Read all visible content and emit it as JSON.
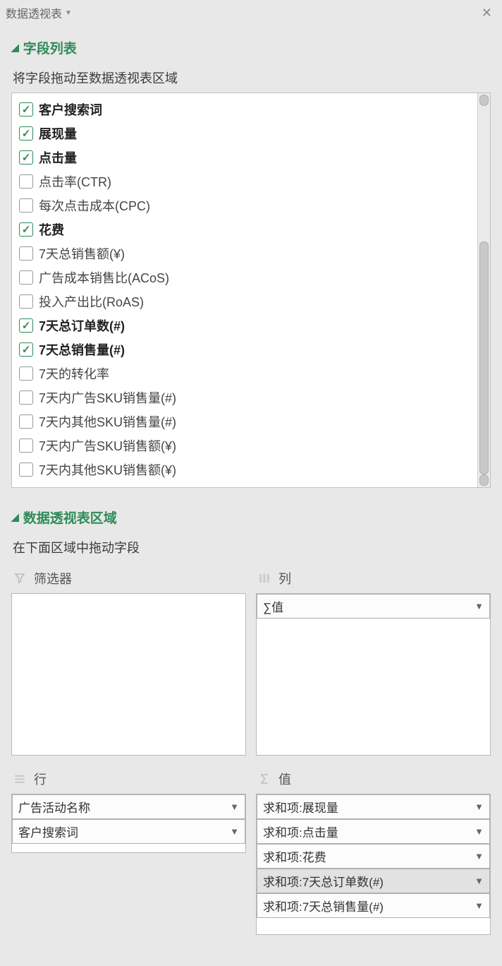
{
  "header": {
    "title": "数据透视表"
  },
  "fieldListSection": {
    "title": "字段列表",
    "instruction": "将字段拖动至数据透视表区域",
    "fields": [
      {
        "label": "客户搜索词",
        "checked": true
      },
      {
        "label": "展现量",
        "checked": true
      },
      {
        "label": "点击量",
        "checked": true
      },
      {
        "label": "点击率(CTR)",
        "checked": false
      },
      {
        "label": "每次点击成本(CPC)",
        "checked": false
      },
      {
        "label": "花费",
        "checked": true
      },
      {
        "label": "7天总销售额(¥)",
        "checked": false
      },
      {
        "label": "广告成本销售比(ACoS)",
        "checked": false
      },
      {
        "label": "投入产出比(RoAS)",
        "checked": false
      },
      {
        "label": "7天总订单数(#)",
        "checked": true
      },
      {
        "label": "7天总销售量(#)",
        "checked": true
      },
      {
        "label": "7天的转化率",
        "checked": false
      },
      {
        "label": "7天内广告SKU销售量(#)",
        "checked": false
      },
      {
        "label": "7天内其他SKU销售量(#)",
        "checked": false
      },
      {
        "label": "7天内广告SKU销售额(¥)",
        "checked": false
      },
      {
        "label": "7天内其他SKU销售额(¥)",
        "checked": false
      }
    ]
  },
  "areaSection": {
    "title": "数据透视表区域",
    "instruction": "在下面区域中拖动字段",
    "filters": {
      "label": "筛选器",
      "items": []
    },
    "columns": {
      "label": "列",
      "items": [
        {
          "label": "∑值",
          "selected": false
        }
      ]
    },
    "rows": {
      "label": "行",
      "items": [
        {
          "label": "广告活动名称",
          "selected": false
        },
        {
          "label": "客户搜索词",
          "selected": false
        }
      ]
    },
    "values": {
      "label": "值",
      "items": [
        {
          "label": "求和项:展现量",
          "selected": false
        },
        {
          "label": "求和项:点击量",
          "selected": false
        },
        {
          "label": "求和项:花费",
          "selected": false
        },
        {
          "label": "求和项:7天总订单数(#)",
          "selected": true
        },
        {
          "label": "求和项:7天总销售量(#)",
          "selected": false
        }
      ]
    }
  }
}
